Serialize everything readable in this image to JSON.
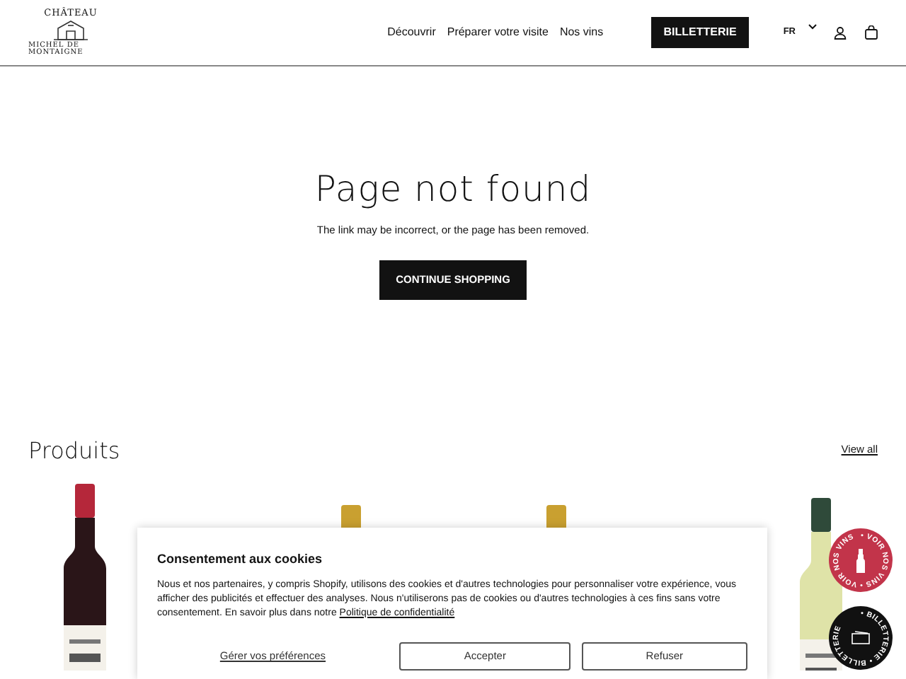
{
  "header": {
    "logo": {
      "top": "CHÂTEAU",
      "bottom": "MICHEL DE MONTAIGNE"
    },
    "nav": [
      "Découvrir",
      "Préparer votre visite",
      "Nos vins"
    ],
    "ticket_button": "BILLETTERIE",
    "language": "FR"
  },
  "error": {
    "title": "Page not found",
    "message": "The link may be incorrect, or the page has been removed.",
    "button": "CONTINUE SHOPPING"
  },
  "products": {
    "heading": "Produits",
    "view_all": "View all"
  },
  "cookie": {
    "title": "Consentement aux cookies",
    "text": "Nous et nos partenaires, y compris Shopify, utilisons des cookies et d'autres technologies pour personnaliser votre expérience, vous afficher des publicités et effectuer des analyses. Nous n'utiliserons pas de cookies ou d'autres technologies à ces fins sans votre consentement. En savoir plus dans notre",
    "link": "Politique de confidentialité",
    "buttons": [
      {
        "kind": "link",
        "label": "Gérer vos préférences"
      },
      {
        "kind": "outline",
        "label": "Accepter"
      },
      {
        "kind": "outline",
        "label": "Refuser"
      }
    ]
  },
  "floating": [
    {
      "kind": "wine",
      "label": "• VOIR NOS VINS • VOIR NOS VINS",
      "color": "#c2344a"
    },
    {
      "kind": "ticket",
      "label": "• BILLETTERIE • BILLETTERIE",
      "color": "#111111"
    }
  ]
}
